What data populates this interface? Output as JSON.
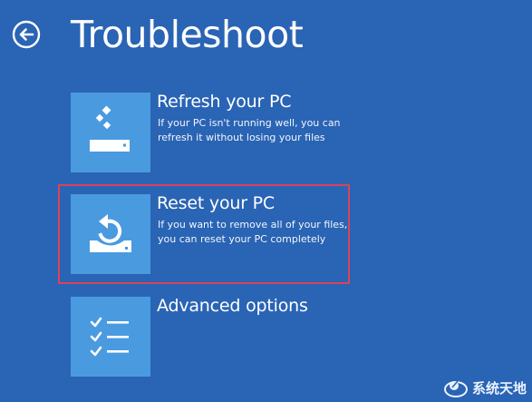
{
  "page": {
    "title": "Troubleshoot",
    "back_icon": "back-arrow-icon",
    "background_color": "#2a64b4",
    "tile_color": "#4a9ae0",
    "selection_color": "#d8445a"
  },
  "options": [
    {
      "title": "Refresh your PC",
      "description": "If your PC isn't running well, you can refresh it without losing your files",
      "icon": "refresh-pc-icon"
    },
    {
      "title": "Reset your PC",
      "description": "If you want to remove all of your files, you can reset your PC completely",
      "icon": "reset-pc-icon",
      "highlighted": true
    },
    {
      "title": "Advanced options",
      "description": "",
      "icon": "checklist-icon"
    }
  ],
  "watermark": {
    "text": "系统天地",
    "icon": "watermark-logo-icon"
  }
}
